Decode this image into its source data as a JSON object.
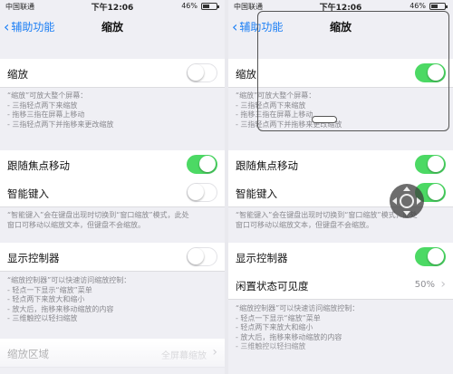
{
  "colors": {
    "accent": "#1a7ef5",
    "toggle_on": "#4cd964"
  },
  "left": {
    "status": {
      "carrier": "中国联通",
      "time": "下午12:06",
      "battery": "46%"
    },
    "nav": {
      "back": "辅助功能",
      "title": "缩放"
    },
    "zoom_cell": {
      "label": "缩放",
      "toggle_on": false
    },
    "zoom_desc": [
      "“缩放”可放大整个屏幕：",
      "- 三指轻点两下来缩放",
      "- 拖移三指在屏幕上移动",
      "- 三指轻点两下并拖移来更改缩放"
    ],
    "follow_focus": {
      "label": "跟随焦点移动",
      "toggle_on": true
    },
    "smart_typing": {
      "label": "智能键入",
      "toggle_on": false
    },
    "smart_desc": [
      "“智能键入”会在键盘出现时切换到“窗口缩放”模式，此处",
      "窗口可移动以缩放文本，但键盘不会缩放。"
    ],
    "show_controller": {
      "label": "显示控制器",
      "toggle_on": false
    },
    "controller_desc": [
      "“缩放控制器”可以快速访问缩放控制：",
      "- 轻点一下显示“缩放”菜单",
      "- 轻点两下来放大和缩小",
      "- 放大后，拖移来移动缩放的内容",
      "- 三维触控以轻扫缩放"
    ],
    "zoom_region": {
      "label": "缩放区域",
      "value": "全屏幕缩放"
    }
  },
  "right": {
    "status": {
      "carrier": "中国联通",
      "time": "下午12:06",
      "battery": "46%"
    },
    "nav": {
      "back": "辅助功能",
      "title": "缩放"
    },
    "zoom_cell": {
      "label": "缩放",
      "toggle_on": true
    },
    "zoom_desc": [
      "“缩放”可放大整个屏幕：",
      "- 三指轻点两下来缩放",
      "- 拖移三指在屏幕上移动",
      "- 三指轻点两下并拖移来更改缩放"
    ],
    "follow_focus": {
      "label": "跟随焦点移动",
      "toggle_on": true
    },
    "smart_typing": {
      "label": "智能键入",
      "toggle_on": true
    },
    "smart_desc": [
      "“智能键入”会在键盘出现时切换到“窗口缩放”模式，此处",
      "窗口可移动以缩放文本，但键盘不会缩放。"
    ],
    "show_controller": {
      "label": "显示控制器",
      "toggle_on": true
    },
    "idle_visibility": {
      "label": "闲置状态可见度",
      "value": "50%"
    },
    "controller_desc": [
      "“缩放控制器”可以快速访问缩放控制：",
      "- 轻点一下显示“缩放”菜单",
      "- 轻点两下来放大和缩小",
      "- 放大后，拖移来移动缩放的内容",
      "- 三维触控以轻扫缩放"
    ]
  }
}
